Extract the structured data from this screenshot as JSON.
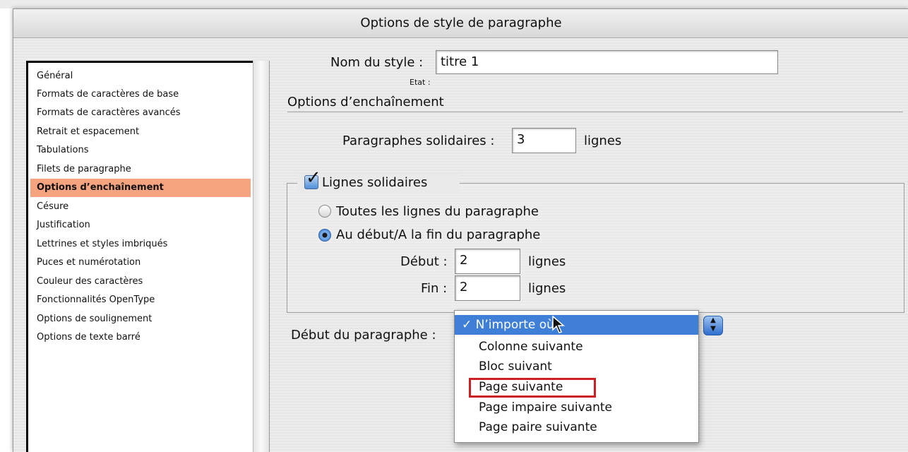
{
  "window": {
    "title": "Options de style de paragraphe"
  },
  "sidebar": {
    "items": [
      {
        "label": "Général",
        "selected": false
      },
      {
        "label": "Formats de caractères de base",
        "selected": false
      },
      {
        "label": "Formats de caractères avancés",
        "selected": false
      },
      {
        "label": "Retrait et espacement",
        "selected": false
      },
      {
        "label": "Tabulations",
        "selected": false
      },
      {
        "label": "Filets de paragraphe",
        "selected": false
      },
      {
        "label": "Options d’enchaînement",
        "selected": true
      },
      {
        "label": "Césure",
        "selected": false
      },
      {
        "label": "Justification",
        "selected": false
      },
      {
        "label": "Lettrines et styles imbriqués",
        "selected": false
      },
      {
        "label": "Puces et numérotation",
        "selected": false
      },
      {
        "label": "Couleur des caractères",
        "selected": false
      },
      {
        "label": "Fonctionnalités OpenType",
        "selected": false
      },
      {
        "label": "Options de soulignement",
        "selected": false
      },
      {
        "label": "Options de texte barré",
        "selected": false
      }
    ],
    "selected_color": "#f6a37f"
  },
  "form": {
    "style_name_label": "Nom du style :",
    "style_name_value": "titre 1",
    "etat_label": "Etat :",
    "section_title": "Options d’enchaînement",
    "keep_paragraphs_label": "Paragraphes solidaires :",
    "keep_paragraphs_value": "3",
    "keep_paragraphs_unit": "lignes",
    "keep_lines_label": "Lignes solidaires",
    "keep_lines_checked": true,
    "radio_all_label": "Toutes les lignes du paragraphe",
    "radio_all_selected": false,
    "radio_startend_label": "Au début/A la fin du paragraphe",
    "radio_startend_selected": true,
    "start_label": "Début :",
    "start_value": "2",
    "start_unit": "lignes",
    "end_label": "Fin :",
    "end_value": "2",
    "end_unit": "lignes",
    "para_start_label": "Début du paragraphe :"
  },
  "dropdown": {
    "checkmark": "✓",
    "options": [
      {
        "label": "N’importe où",
        "checked": true
      },
      {
        "label": "Colonne suivante",
        "checked": false
      },
      {
        "label": "Bloc suivant",
        "checked": false
      },
      {
        "label": "Page suivante",
        "checked": false,
        "highlighted": true
      },
      {
        "label": "Page impaire suivante",
        "checked": false
      },
      {
        "label": "Page paire suivante",
        "checked": false
      }
    ],
    "selected_color": "#3f7fd8",
    "highlight_color": "#cc1f24"
  }
}
